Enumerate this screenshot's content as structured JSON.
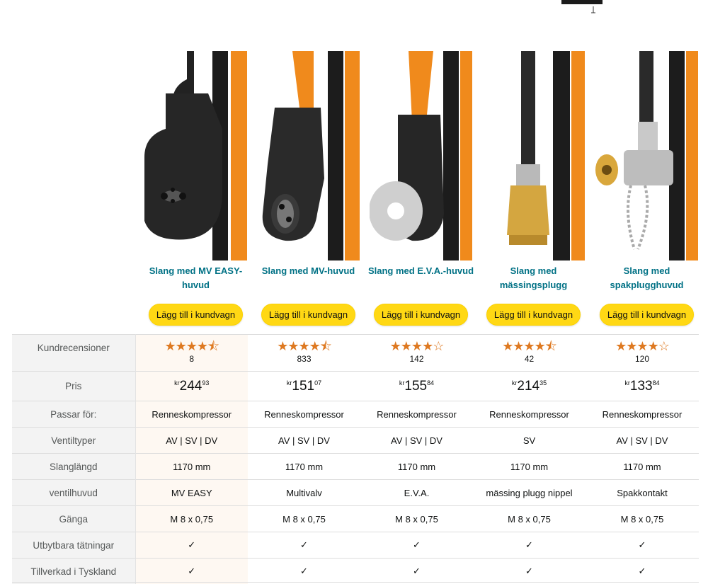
{
  "colors": {
    "link": "#007185",
    "button": "#ffd814",
    "star": "#de7921",
    "label_bg": "#f3f3f3",
    "highlight_bg": "#fef8f2"
  },
  "products": [
    {
      "title": "Slang med MV EASY-huvud",
      "button": "Lägg till i kundvagn",
      "rating_stars": "★★★★⯪",
      "rating": 4.5,
      "reviews": "8",
      "currency": "kr",
      "price_whole": "244",
      "price_fraction": "93",
      "fits": "Renneskompressor",
      "valves": "AV | SV | DV",
      "hose_length": "1170 mm",
      "valve_head": "MV EASY",
      "thread": "M 8 x 0,75",
      "replaceable_seals": "✓",
      "made_in_germany": "✓",
      "image": "mv-easy-head"
    },
    {
      "title": "Slang med MV-huvud",
      "button": "Lägg till i kundvagn",
      "rating_stars": "★★★★⯪",
      "rating": 4.5,
      "reviews": "833",
      "currency": "kr",
      "price_whole": "151",
      "price_fraction": "07",
      "fits": "Renneskompressor",
      "valves": "AV | SV | DV",
      "hose_length": "1170 mm",
      "valve_head": "Multivalv",
      "thread": "M 8 x 0,75",
      "replaceable_seals": "✓",
      "made_in_germany": "✓",
      "image": "mv-head"
    },
    {
      "title": "Slang med E.V.A.-huvud",
      "button": "Lägg till i kundvagn",
      "rating_stars": "★★★★☆",
      "rating": 4,
      "reviews": "142",
      "currency": "kr",
      "price_whole": "155",
      "price_fraction": "84",
      "fits": "Renneskompressor",
      "valves": "AV | SV | DV",
      "hose_length": "1170 mm",
      "valve_head": "E.V.A.",
      "thread": "M 8 x 0,75",
      "replaceable_seals": "✓",
      "made_in_germany": "✓",
      "image": "eva-head"
    },
    {
      "title": "Slang med mässingsplugg",
      "button": "Lägg till i kundvagn",
      "rating_stars": "★★★★⯪",
      "rating": 4.5,
      "reviews": "42",
      "currency": "kr",
      "price_whole": "214",
      "price_fraction": "35",
      "fits": "Renneskompressor",
      "valves": "SV",
      "hose_length": "1170 mm",
      "valve_head": "mässing plugg nippel",
      "thread": "M 8 x 0,75",
      "replaceable_seals": "✓",
      "made_in_germany": "✓",
      "image": "brass-plug"
    },
    {
      "title": "Slang med spakplugghuvud",
      "button": "Lägg till i kundvagn",
      "rating_stars": "★★★★☆",
      "rating": 4,
      "reviews": "120",
      "currency": "kr",
      "price_whole": "133",
      "price_fraction": "84",
      "fits": "Renneskompressor",
      "valves": "AV | SV | DV",
      "hose_length": "1170 mm",
      "valve_head": "Spakkontakt",
      "thread": "M 8 x 0,75",
      "replaceable_seals": "✓",
      "made_in_germany": "✓",
      "image": "lever-plug"
    }
  ],
  "labels": {
    "reviews": "Kundrecensioner",
    "price": "Pris",
    "fits": "Passar för:",
    "valves": "Ventiltyper",
    "hose_length": "Slanglängd",
    "valve_head": "ventilhuvud",
    "thread": "Gänga",
    "replaceable_seals": "Utbytbara tätningar",
    "made_in_germany": "Tillverkad i Tyskland"
  }
}
